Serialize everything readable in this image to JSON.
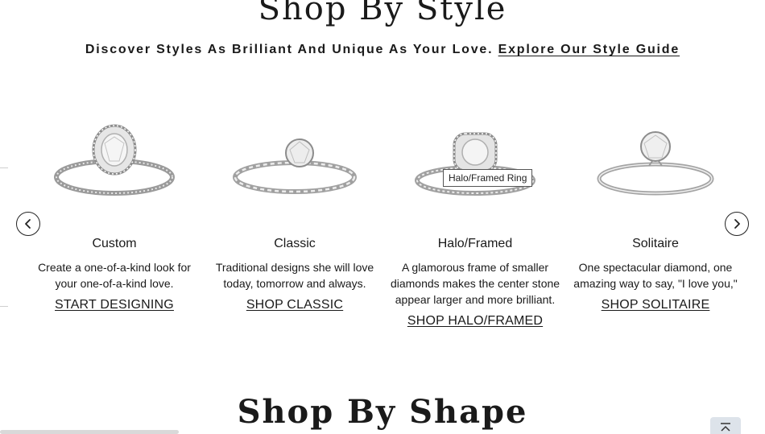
{
  "section_title": "Shop By Style",
  "subtitle": {
    "text": "Discover Styles As Brilliant And Unique As Your Love.",
    "link": "Explore Our Style Guide"
  },
  "carousel": {
    "prev_icon": "chevron-left-icon",
    "next_icon": "chevron-right-icon",
    "cards": [
      {
        "title": "Custom",
        "description": "Create a one-of-a-kind look for your one-of-a-kind love.",
        "link": "START DESIGNING"
      },
      {
        "title": "Classic",
        "description": "Traditional designs she will love today, tomorrow and always.",
        "link": "SHOP CLASSIC"
      },
      {
        "title": "Halo/Framed",
        "description": "A glamorous frame of smaller diamonds makes the center stone appear larger and more brilliant.",
        "link": "SHOP HALO/FRAMED"
      },
      {
        "title": "Solitaire",
        "description": "One spectacular diamond, one amazing way to say, \"I love you,\"",
        "link": "SHOP SOLITAIRE"
      }
    ]
  },
  "tooltip": "Halo/Framed Ring",
  "next_section_title": "Shop By Shape",
  "back_to_top_icon": "arrow-up-to-line-icon",
  "colors": {
    "text": "#1a1a1a",
    "back_to_top_bg": "#dde3ea"
  }
}
